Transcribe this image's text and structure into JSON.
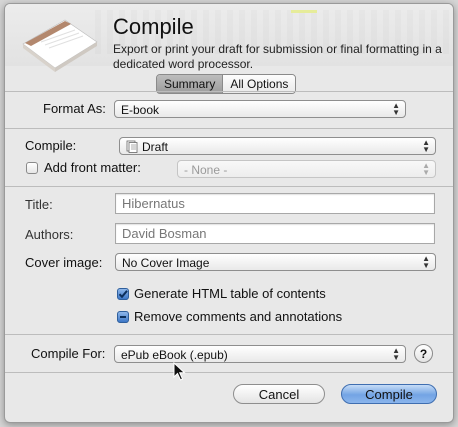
{
  "dialog": {
    "title": "Compile",
    "subtitle": "Export or print your draft for submission or final formatting in a dedicated word processor."
  },
  "tabs": {
    "summary": "Summary",
    "all_options": "All Options",
    "selected": "Summary"
  },
  "format": {
    "label": "Format As:",
    "value": "E-book"
  },
  "compile": {
    "label": "Compile:",
    "value": "Draft"
  },
  "front_matter": {
    "label": "Add front matter:",
    "value": "- None -",
    "checked": false
  },
  "title_field": {
    "label": "Title:",
    "placeholder": "Hibernatus"
  },
  "authors_field": {
    "label": "Authors:",
    "placeholder": "David Bosman"
  },
  "cover": {
    "label": "Cover image:",
    "value": "No Cover Image"
  },
  "options": {
    "toc_label": "Generate HTML table of contents",
    "toc_checked": true,
    "remove_label": "Remove comments and annotations",
    "remove_state": "mixed"
  },
  "compile_for": {
    "label": "Compile For:",
    "value": "ePub eBook (.epub)"
  },
  "help_label": "?",
  "buttons": {
    "cancel": "Cancel",
    "compile": "Compile"
  },
  "colors": {
    "accent": "#3d77c6",
    "default_button": "#73a4e4"
  }
}
